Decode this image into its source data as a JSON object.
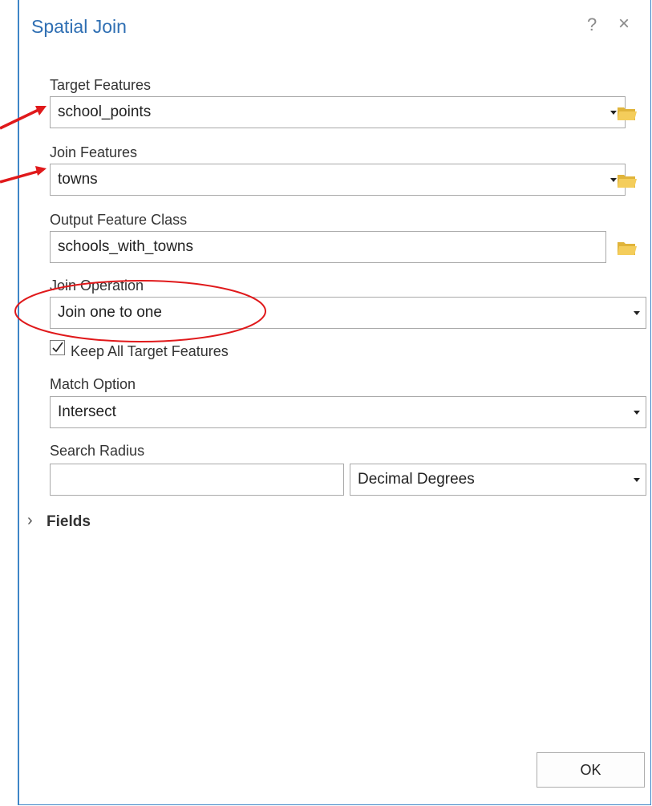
{
  "dialog": {
    "title": "Spatial Join",
    "help_glyph": "?",
    "close_glyph": "×"
  },
  "params": {
    "target_features": {
      "label": "Target Features",
      "value": "school_points"
    },
    "join_features": {
      "label": "Join Features",
      "value": "towns"
    },
    "output_feature_class": {
      "label": "Output Feature Class",
      "value": "schools_with_towns"
    },
    "join_operation": {
      "label": "Join Operation",
      "value": "Join one to one"
    },
    "keep_all_target": {
      "label": "Keep All Target Features",
      "checked": true
    },
    "match_option": {
      "label": "Match Option",
      "value": "Intersect"
    },
    "search_radius": {
      "label": "Search Radius",
      "value": "",
      "unit": "Decimal Degrees"
    }
  },
  "fields_section": {
    "label": "Fields",
    "chevron": "›"
  },
  "ok_label": "OK",
  "colors": {
    "title_blue": "#2f6fb3",
    "frame_blue": "#3f86c7",
    "annotation_red": "#e0191b",
    "folder_yellow": "#f2c94c"
  }
}
